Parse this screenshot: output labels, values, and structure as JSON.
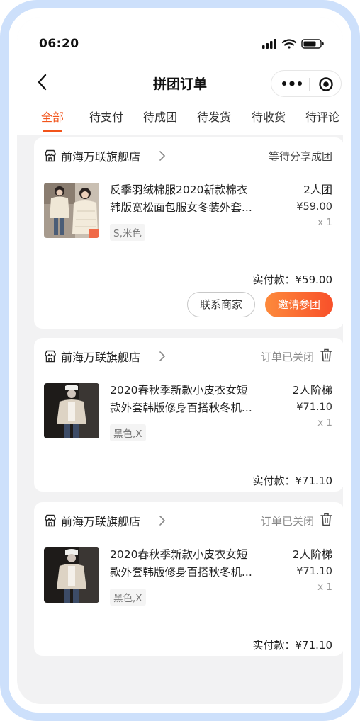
{
  "status_bar": {
    "time": "06:20"
  },
  "nav": {
    "title": "拼团订单",
    "back_icon": "back-arrow-icon",
    "more_icon": "more-dots-icon",
    "close_icon": "target-circle-icon"
  },
  "tabs": [
    {
      "label": "全部",
      "active": true
    },
    {
      "label": "待支付"
    },
    {
      "label": "待成团"
    },
    {
      "label": "待发货"
    },
    {
      "label": "待收货"
    },
    {
      "label": "待评论"
    }
  ],
  "orders": [
    {
      "shop": "前海万联旗舰店",
      "status": "等待分享成团",
      "title_l1": "反季羽绒棉服2020新款棉衣",
      "title_l2": "韩版宽松面包服女冬装外套...",
      "spec": "S,米色",
      "group_type": "2人团",
      "price": "¥59.00",
      "qty": "x 1",
      "paid": "实付款：¥59.00",
      "buttons": [
        "联系商家",
        "邀请参团"
      ]
    },
    {
      "shop": "前海万联旗舰店",
      "status": "订单已关闭",
      "title_l1": "2020春秋季新款小皮衣女短",
      "title_l2": "款外套韩版修身百搭秋冬机...",
      "spec": "黑色,X",
      "group_type": "2人阶梯",
      "price": "¥71.10",
      "qty": "x 1",
      "paid": "实付款：¥71.10"
    },
    {
      "shop": "前海万联旗舰店",
      "status": "订单已关闭",
      "title_l1": "2020春秋季新款小皮衣女短",
      "title_l2": "款外套韩版修身百搭秋冬机...",
      "spec": "黑色,X",
      "group_type": "2人阶梯",
      "price": "¥71.10",
      "qty": "x 1",
      "paid": "实付款：¥71.10"
    }
  ],
  "colors": {
    "accent": "#f2541b",
    "button_gradient_start": "#fd8a3c",
    "button_gradient_end": "#f8502a",
    "frame": "#cde0fb"
  }
}
